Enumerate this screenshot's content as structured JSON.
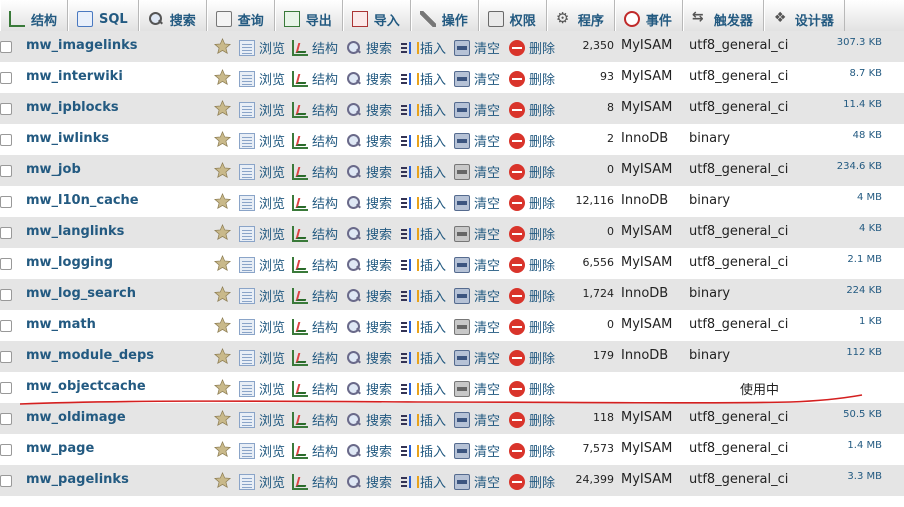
{
  "tabs": [
    {
      "key": "structure",
      "label": "结构",
      "icon": "structure-icon"
    },
    {
      "key": "sql",
      "label": "SQL",
      "icon": "sql-icon"
    },
    {
      "key": "search",
      "label": "搜索",
      "icon": "search-icon"
    },
    {
      "key": "query",
      "label": "查询",
      "icon": "query-icon"
    },
    {
      "key": "export",
      "label": "导出",
      "icon": "export-icon"
    },
    {
      "key": "import",
      "label": "导入",
      "icon": "import-icon"
    },
    {
      "key": "operations",
      "label": "操作",
      "icon": "wrench-icon"
    },
    {
      "key": "privileges",
      "label": "权限",
      "icon": "privileges-icon"
    },
    {
      "key": "routines",
      "label": "程序",
      "icon": "gear-icon"
    },
    {
      "key": "events",
      "label": "事件",
      "icon": "clock-icon"
    },
    {
      "key": "triggers",
      "label": "触发器",
      "icon": "trigger-icon"
    },
    {
      "key": "designer",
      "label": "设计器",
      "icon": "designer-icon"
    }
  ],
  "actions": {
    "browse": "浏览",
    "structure": "结构",
    "search": "搜索",
    "insert": "插入",
    "empty": "清空",
    "drop": "删除"
  },
  "tables": [
    {
      "name": "mw_imagelinks",
      "rows": "2,350",
      "engine": "MyISAM",
      "collation": "utf8_general_ci",
      "size": "307.3 KB"
    },
    {
      "name": "mw_interwiki",
      "rows": "93",
      "engine": "MyISAM",
      "collation": "utf8_general_ci",
      "size": "8.7 KB"
    },
    {
      "name": "mw_ipblocks",
      "rows": "8",
      "engine": "MyISAM",
      "collation": "utf8_general_ci",
      "size": "11.4 KB"
    },
    {
      "name": "mw_iwlinks",
      "rows": "2",
      "engine": "InnoDB",
      "collation": "binary",
      "size": "48 KB"
    },
    {
      "name": "mw_job",
      "rows": "0",
      "engine": "MyISAM",
      "collation": "utf8_general_ci",
      "size": "234.6 KB"
    },
    {
      "name": "mw_l10n_cache",
      "rows": "12,116",
      "engine": "InnoDB",
      "collation": "binary",
      "size": "4 MB"
    },
    {
      "name": "mw_langlinks",
      "rows": "0",
      "engine": "MyISAM",
      "collation": "utf8_general_ci",
      "size": "4 KB"
    },
    {
      "name": "mw_logging",
      "rows": "6,556",
      "engine": "MyISAM",
      "collation": "utf8_general_ci",
      "size": "2.1 MB"
    },
    {
      "name": "mw_log_search",
      "rows": "1,724",
      "engine": "InnoDB",
      "collation": "binary",
      "size": "224 KB"
    },
    {
      "name": "mw_math",
      "rows": "0",
      "engine": "MyISAM",
      "collation": "utf8_general_ci",
      "size": "1 KB"
    },
    {
      "name": "mw_module_deps",
      "rows": "179",
      "engine": "InnoDB",
      "collation": "binary",
      "size": "112 KB"
    },
    {
      "name": "mw_objectcache",
      "rows": "",
      "engine": "",
      "collation": "",
      "size": "",
      "status": "使用中"
    },
    {
      "name": "mw_oldimage",
      "rows": "118",
      "engine": "MyISAM",
      "collation": "utf8_general_ci",
      "size": "50.5 KB"
    },
    {
      "name": "mw_page",
      "rows": "7,573",
      "engine": "MyISAM",
      "collation": "utf8_general_ci",
      "size": "1.4 MB"
    },
    {
      "name": "mw_pagelinks",
      "rows": "24,399",
      "engine": "MyISAM",
      "collation": "utf8_general_ci",
      "size": "3.3 MB"
    }
  ],
  "annotation_color": "#d42020"
}
